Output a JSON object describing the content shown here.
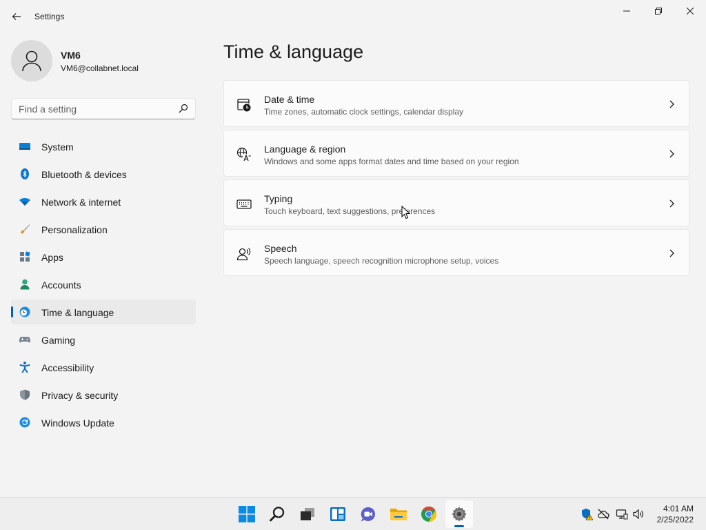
{
  "window": {
    "title": "Settings"
  },
  "profile": {
    "name": "VM6",
    "email": "VM6@collabnet.local"
  },
  "search": {
    "placeholder": "Find a setting"
  },
  "nav": {
    "items": [
      {
        "label": "System",
        "icon": "monitor-icon"
      },
      {
        "label": "Bluetooth & devices",
        "icon": "bluetooth-icon"
      },
      {
        "label": "Network & internet",
        "icon": "wifi-icon"
      },
      {
        "label": "Personalization",
        "icon": "brush-icon"
      },
      {
        "label": "Apps",
        "icon": "apps-icon"
      },
      {
        "label": "Accounts",
        "icon": "person-icon"
      },
      {
        "label": "Time & language",
        "icon": "globe-clock-icon",
        "active": true
      },
      {
        "label": "Gaming",
        "icon": "gamepad-icon"
      },
      {
        "label": "Accessibility",
        "icon": "accessibility-icon"
      },
      {
        "label": "Privacy & security",
        "icon": "shield-icon"
      },
      {
        "label": "Windows Update",
        "icon": "update-icon"
      }
    ]
  },
  "main": {
    "title": "Time & language",
    "cards": [
      {
        "title": "Date & time",
        "subtitle": "Time zones, automatic clock settings, calendar display",
        "icon": "calendar-clock-icon"
      },
      {
        "title": "Language & region",
        "subtitle": "Windows and some apps format dates and time based on your region",
        "icon": "language-icon"
      },
      {
        "title": "Typing",
        "subtitle": "Touch keyboard, text suggestions, preferences",
        "icon": "keyboard-icon"
      },
      {
        "title": "Speech",
        "subtitle": "Speech language, speech recognition microphone setup, voices",
        "icon": "speech-icon"
      }
    ]
  },
  "taskbar": {
    "apps": [
      "start-icon",
      "search-icon",
      "task-view-icon",
      "widgets-icon",
      "chat-icon",
      "file-explorer-icon",
      "chrome-icon",
      "settings-icon"
    ],
    "time": "4:01 AM",
    "date": "2/25/2022"
  },
  "colors": {
    "accent": "#005fb8",
    "background": "#f3f3f3",
    "card": "#fbfbfb"
  }
}
